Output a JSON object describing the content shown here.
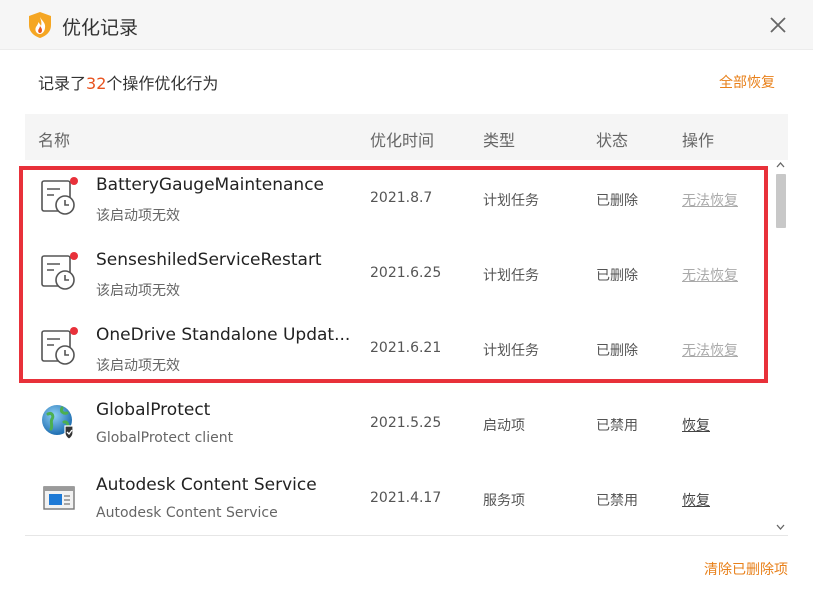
{
  "window": {
    "title": "优化记录"
  },
  "summary": {
    "prefix": "记录了",
    "count": "32",
    "suffix": "个操作优化行为"
  },
  "restore_all_label": "全部恢复",
  "columns": {
    "name": "名称",
    "time": "优化时间",
    "type": "类型",
    "status": "状态",
    "action": "操作"
  },
  "rows": [
    {
      "name": "BatteryGaugeMaintenance",
      "desc": "该启动项无效",
      "date": "2021.8.7",
      "type": "计划任务",
      "status": "已删除",
      "action": "无法恢复",
      "icon": "scheduled-task-icon",
      "action_enabled": false
    },
    {
      "name": "SenseshiledServiceRestart",
      "desc": "该启动项无效",
      "date": "2021.6.25",
      "type": "计划任务",
      "status": "已删除",
      "action": "无法恢复",
      "icon": "scheduled-task-icon",
      "action_enabled": false
    },
    {
      "name": "OneDrive Standalone Updat...",
      "desc": "该启动项无效",
      "date": "2021.6.21",
      "type": "计划任务",
      "status": "已删除",
      "action": "无法恢复",
      "icon": "scheduled-task-icon",
      "action_enabled": false
    },
    {
      "name": "GlobalProtect",
      "desc": "GlobalProtect client",
      "date": "2021.5.25",
      "type": "启动项",
      "status": "已禁用",
      "action": "恢复",
      "icon": "globe-shield-icon",
      "action_enabled": true
    },
    {
      "name": "Autodesk Content Service",
      "desc": "Autodesk Content Service",
      "date": "2021.4.17",
      "type": "服务项",
      "status": "已禁用",
      "action": "恢复",
      "icon": "service-window-icon",
      "action_enabled": true
    }
  ],
  "clear_deleted_label": "清除已删除项",
  "colors": {
    "accent_orange": "#e8801a",
    "count_red": "#e8531f",
    "highlight_red": "#e8313a"
  }
}
